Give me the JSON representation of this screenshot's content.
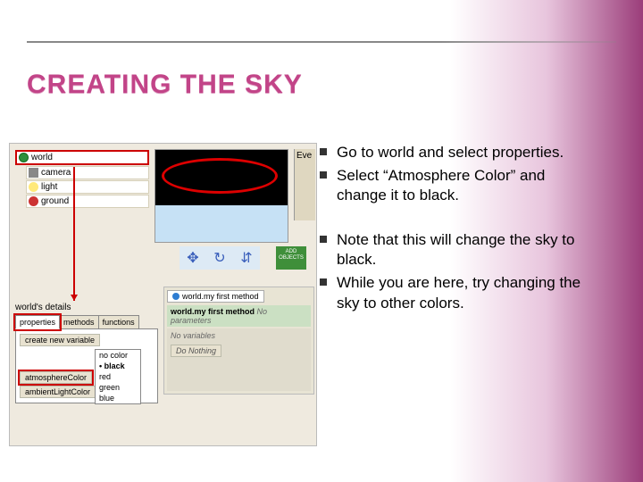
{
  "title": "CREATING THE SKY",
  "tree": {
    "world": "world",
    "camera": "camera",
    "light": "light",
    "ground": "ground"
  },
  "viewport": {
    "eve_label": "Eve",
    "add_objects": "ADD OBJECTS"
  },
  "details": {
    "heading": "world's details",
    "tab_properties": "properties",
    "tab_methods": "methods",
    "tab_functions": "functions",
    "create_var": "create new variable",
    "atmosphere": "atmosphereColor",
    "ambient": "ambientLightColor"
  },
  "colors": {
    "none": "no color",
    "black": "black",
    "red": "red",
    "green": "green",
    "blue": "blue"
  },
  "editor": {
    "tab": "world.my first method",
    "header": "world.my first method",
    "noparams": "No parameters",
    "novars": "No variables",
    "donothing": "Do Nothing"
  },
  "bullets1": [
    "Go to world and select properties.",
    "Select “Atmosphere Color” and change it to black."
  ],
  "bullets2": [
    "Note that this will change the sky to black.",
    "While you are here, try changing the sky to other colors."
  ]
}
